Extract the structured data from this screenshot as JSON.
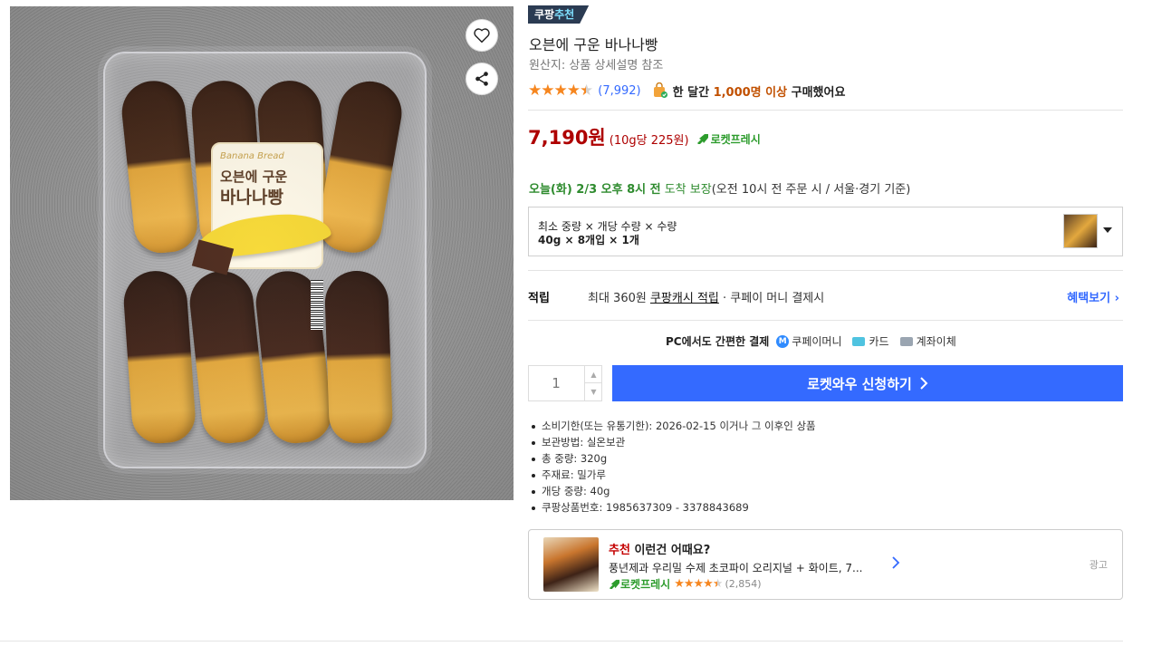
{
  "badge": {
    "prefix": "쿠팡",
    "accent": "추천"
  },
  "product": {
    "title": "오븐에 구운 바나나빵",
    "origin": "원산지: 상품 상세설명 참조",
    "rating": 4.5,
    "review_count": "(7,992)",
    "buyer_prefix": "한 달간 ",
    "buyer_highlight": "1,000명 이상",
    "buyer_suffix": " 구매했어요",
    "image_label_brand": "Banana Bread",
    "image_label_line1": "오븐에 구운",
    "image_label_line2": "바나나빵"
  },
  "price": {
    "amount": "7,190원",
    "unit": "(10g당 225원)",
    "badge": "로켓프레시"
  },
  "delivery": {
    "date": "오늘(화) 2/3 오후 8시 전",
    "guarantee": " 도착 보장",
    "condition": "(오전 10시 전 주문 시 / 서울·경기 기준)"
  },
  "option": {
    "label": "최소 중량 × 개당 수량 × 수량",
    "value": "40g × 8개입 × 1개"
  },
  "reward": {
    "title": "적립",
    "prefix": "최대 360원 ",
    "link": "쿠팡캐시 적립",
    "suffix": " · 쿠페이 머니 결제시",
    "benefit": "혜택보기 ›"
  },
  "payment": {
    "lead": "PC에서도 간편한 결제",
    "coupay_mark": "M",
    "coupay": "쿠페이머니",
    "card": "카드",
    "bank": "계좌이체"
  },
  "purchase": {
    "quantity": "1",
    "cta": "로켓와우 신청하기"
  },
  "details": [
    "소비기한(또는 유통기한): 2026-02-15 이거나 그 이후인 상품",
    "보관방법: 실온보관",
    "총 중량: 320g",
    "주재료: 밀가루",
    "개당 중량: 40g",
    "쿠팡상품번호: 1985637309 - 3378843689"
  ],
  "recommendation": {
    "head_red": "추천",
    "head": " 이런건 어때요?",
    "name": "풍년제과 우리밀 수제 초코파이 오리지널 + 화이트, 7...",
    "badge": "로켓프레시",
    "rating": 4.5,
    "count": "(2,854)",
    "ad": "광고"
  },
  "colors": {
    "accent_blue": "#346aff",
    "price_red": "#ae0000",
    "star_orange": "#f6861f",
    "fresh_green": "#2d9c2d"
  }
}
